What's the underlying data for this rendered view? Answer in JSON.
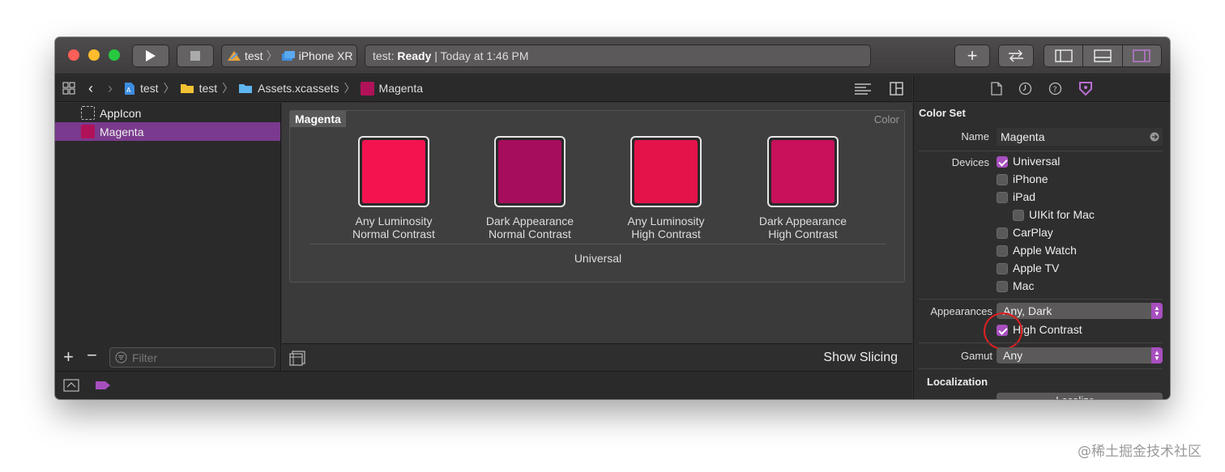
{
  "toolbar": {
    "scheme_target": "test",
    "scheme_device": "iPhone XR",
    "activity_prefix": "test:",
    "activity_status": "Ready",
    "activity_time": "| Today at 1:46 PM"
  },
  "jumpbar": {
    "items": [
      "test",
      "test",
      "Assets.xcassets",
      "Magenta"
    ]
  },
  "navigator": {
    "items": [
      {
        "label": "AppIcon"
      },
      {
        "label": "Magenta"
      }
    ],
    "filter_placeholder": "Filter"
  },
  "editor": {
    "set_name": "Magenta",
    "set_type": "Color",
    "swatches": [
      {
        "line1": "Any Luminosity",
        "line2": "Normal Contrast",
        "color": "#f5134f"
      },
      {
        "line1": "Dark Appearance",
        "line2": "Normal Contrast",
        "color": "#a60d5c"
      },
      {
        "line1": "Any Luminosity",
        "line2": "High Contrast",
        "color": "#e4134a"
      },
      {
        "line1": "Dark Appearance",
        "line2": "High Contrast",
        "color": "#c8105b"
      }
    ],
    "group_label": "Universal",
    "show_slicing": "Show Slicing"
  },
  "inspector": {
    "section_title": "Color Set",
    "name_label": "Name",
    "name_value": "Magenta",
    "devices_label": "Devices",
    "devices": [
      {
        "label": "Universal",
        "checked": true
      },
      {
        "label": "iPhone",
        "checked": false
      },
      {
        "label": "iPad",
        "checked": false
      },
      {
        "label": "UIKit for Mac",
        "checked": false
      },
      {
        "label": "CarPlay",
        "checked": false
      },
      {
        "label": "Apple Watch",
        "checked": false
      },
      {
        "label": "Apple TV",
        "checked": false
      },
      {
        "label": "Mac",
        "checked": false
      }
    ],
    "appearances_label": "Appearances",
    "appearances_value": "Any, Dark",
    "high_contrast_label": "High Contrast",
    "high_contrast_checked": true,
    "gamut_label": "Gamut",
    "gamut_value": "Any",
    "localization_title": "Localization",
    "localize_button": "Localize..."
  },
  "watermark": "@稀土掘金技术社区",
  "colors": {
    "accent": "#a74fbe",
    "selection": "#7a3a8d",
    "annotation": "#e02020"
  }
}
